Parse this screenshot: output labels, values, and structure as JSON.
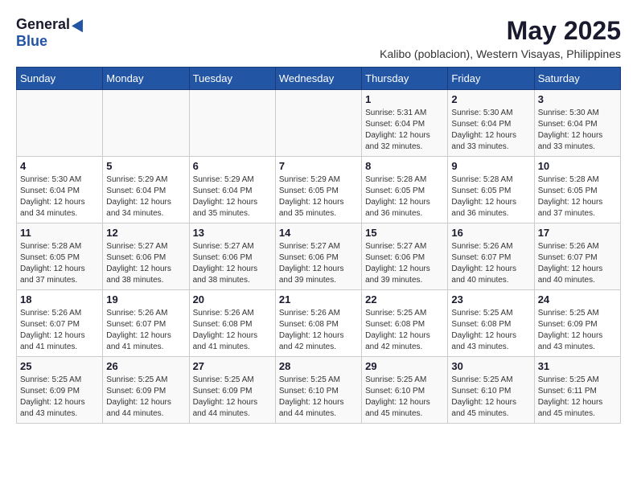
{
  "logo": {
    "general": "General",
    "blue": "Blue"
  },
  "title": {
    "month_year": "May 2025",
    "location": "Kalibo (poblacion), Western Visayas, Philippines"
  },
  "days_of_week": [
    "Sunday",
    "Monday",
    "Tuesday",
    "Wednesday",
    "Thursday",
    "Friday",
    "Saturday"
  ],
  "weeks": [
    [
      {
        "day": "",
        "info": ""
      },
      {
        "day": "",
        "info": ""
      },
      {
        "day": "",
        "info": ""
      },
      {
        "day": "",
        "info": ""
      },
      {
        "day": "1",
        "info": "Sunrise: 5:31 AM\nSunset: 6:04 PM\nDaylight: 12 hours\nand 32 minutes."
      },
      {
        "day": "2",
        "info": "Sunrise: 5:30 AM\nSunset: 6:04 PM\nDaylight: 12 hours\nand 33 minutes."
      },
      {
        "day": "3",
        "info": "Sunrise: 5:30 AM\nSunset: 6:04 PM\nDaylight: 12 hours\nand 33 minutes."
      }
    ],
    [
      {
        "day": "4",
        "info": "Sunrise: 5:30 AM\nSunset: 6:04 PM\nDaylight: 12 hours\nand 34 minutes."
      },
      {
        "day": "5",
        "info": "Sunrise: 5:29 AM\nSunset: 6:04 PM\nDaylight: 12 hours\nand 34 minutes."
      },
      {
        "day": "6",
        "info": "Sunrise: 5:29 AM\nSunset: 6:04 PM\nDaylight: 12 hours\nand 35 minutes."
      },
      {
        "day": "7",
        "info": "Sunrise: 5:29 AM\nSunset: 6:05 PM\nDaylight: 12 hours\nand 35 minutes."
      },
      {
        "day": "8",
        "info": "Sunrise: 5:28 AM\nSunset: 6:05 PM\nDaylight: 12 hours\nand 36 minutes."
      },
      {
        "day": "9",
        "info": "Sunrise: 5:28 AM\nSunset: 6:05 PM\nDaylight: 12 hours\nand 36 minutes."
      },
      {
        "day": "10",
        "info": "Sunrise: 5:28 AM\nSunset: 6:05 PM\nDaylight: 12 hours\nand 37 minutes."
      }
    ],
    [
      {
        "day": "11",
        "info": "Sunrise: 5:28 AM\nSunset: 6:05 PM\nDaylight: 12 hours\nand 37 minutes."
      },
      {
        "day": "12",
        "info": "Sunrise: 5:27 AM\nSunset: 6:06 PM\nDaylight: 12 hours\nand 38 minutes."
      },
      {
        "day": "13",
        "info": "Sunrise: 5:27 AM\nSunset: 6:06 PM\nDaylight: 12 hours\nand 38 minutes."
      },
      {
        "day": "14",
        "info": "Sunrise: 5:27 AM\nSunset: 6:06 PM\nDaylight: 12 hours\nand 39 minutes."
      },
      {
        "day": "15",
        "info": "Sunrise: 5:27 AM\nSunset: 6:06 PM\nDaylight: 12 hours\nand 39 minutes."
      },
      {
        "day": "16",
        "info": "Sunrise: 5:26 AM\nSunset: 6:07 PM\nDaylight: 12 hours\nand 40 minutes."
      },
      {
        "day": "17",
        "info": "Sunrise: 5:26 AM\nSunset: 6:07 PM\nDaylight: 12 hours\nand 40 minutes."
      }
    ],
    [
      {
        "day": "18",
        "info": "Sunrise: 5:26 AM\nSunset: 6:07 PM\nDaylight: 12 hours\nand 41 minutes."
      },
      {
        "day": "19",
        "info": "Sunrise: 5:26 AM\nSunset: 6:07 PM\nDaylight: 12 hours\nand 41 minutes."
      },
      {
        "day": "20",
        "info": "Sunrise: 5:26 AM\nSunset: 6:08 PM\nDaylight: 12 hours\nand 41 minutes."
      },
      {
        "day": "21",
        "info": "Sunrise: 5:26 AM\nSunset: 6:08 PM\nDaylight: 12 hours\nand 42 minutes."
      },
      {
        "day": "22",
        "info": "Sunrise: 5:25 AM\nSunset: 6:08 PM\nDaylight: 12 hours\nand 42 minutes."
      },
      {
        "day": "23",
        "info": "Sunrise: 5:25 AM\nSunset: 6:08 PM\nDaylight: 12 hours\nand 43 minutes."
      },
      {
        "day": "24",
        "info": "Sunrise: 5:25 AM\nSunset: 6:09 PM\nDaylight: 12 hours\nand 43 minutes."
      }
    ],
    [
      {
        "day": "25",
        "info": "Sunrise: 5:25 AM\nSunset: 6:09 PM\nDaylight: 12 hours\nand 43 minutes."
      },
      {
        "day": "26",
        "info": "Sunrise: 5:25 AM\nSunset: 6:09 PM\nDaylight: 12 hours\nand 44 minutes."
      },
      {
        "day": "27",
        "info": "Sunrise: 5:25 AM\nSunset: 6:09 PM\nDaylight: 12 hours\nand 44 minutes."
      },
      {
        "day": "28",
        "info": "Sunrise: 5:25 AM\nSunset: 6:10 PM\nDaylight: 12 hours\nand 44 minutes."
      },
      {
        "day": "29",
        "info": "Sunrise: 5:25 AM\nSunset: 6:10 PM\nDaylight: 12 hours\nand 45 minutes."
      },
      {
        "day": "30",
        "info": "Sunrise: 5:25 AM\nSunset: 6:10 PM\nDaylight: 12 hours\nand 45 minutes."
      },
      {
        "day": "31",
        "info": "Sunrise: 5:25 AM\nSunset: 6:11 PM\nDaylight: 12 hours\nand 45 minutes."
      }
    ]
  ]
}
